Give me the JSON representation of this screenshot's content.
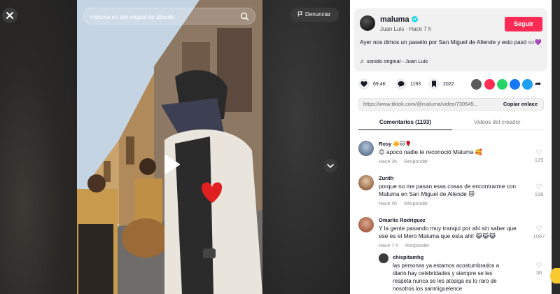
{
  "search": {
    "value": "maluma en san miguel de allende"
  },
  "report": {
    "label": "Denunciar"
  },
  "post": {
    "author": "maluma",
    "subtitle": "Juan Luis · Hace 7 h",
    "follow_label": "Seguir",
    "caption": "Ayer nos dimos un paseito por San Miguel de Allende y esto pasó",
    "caption_tag": "MX",
    "sound": "sonido original - Juan Luis"
  },
  "stats": {
    "likes": "69,4K",
    "comments": "1193",
    "saves": "2022"
  },
  "link": {
    "url": "https://www.tiktok.com/@maluma/video/730545...",
    "copy_label": "Copiar enlace"
  },
  "tabs": [
    {
      "label": "Comentarios (1193)"
    },
    {
      "label": "Videos del creador"
    }
  ],
  "comments": [
    {
      "name": "Rosy",
      "name_suffix": "🌼🐱🌹",
      "text": "😊 apoco nadie te reconoció Maluma 🥰",
      "time": "Hace 3h",
      "reply_label": "Responder",
      "likes": "129"
    },
    {
      "name": "Zurith",
      "text": "porque no me pasan esas cosas de encontrarme con Maluma en San Miguel de Allende 😿",
      "time": "Hace 4h",
      "reply_label": "Responder",
      "likes": "198"
    },
    {
      "name": "Omarlis Rodriguez",
      "text": "Y la gente pasando muy tranqui por ahi sin saber que ese es el Mero Maluma que esta ahi! 😹😹😹",
      "time": "Hace 7 h",
      "reply_label": "Responder",
      "likes": "1067"
    }
  ],
  "reply": {
    "name": "chispitamhg",
    "text": "las personas ya estamos acostumbrados a diario hay celebridades y siempre se les respeta nunca se les atosiga es lo raro de nosotros los sanmiguelence",
    "likes": "36"
  }
}
